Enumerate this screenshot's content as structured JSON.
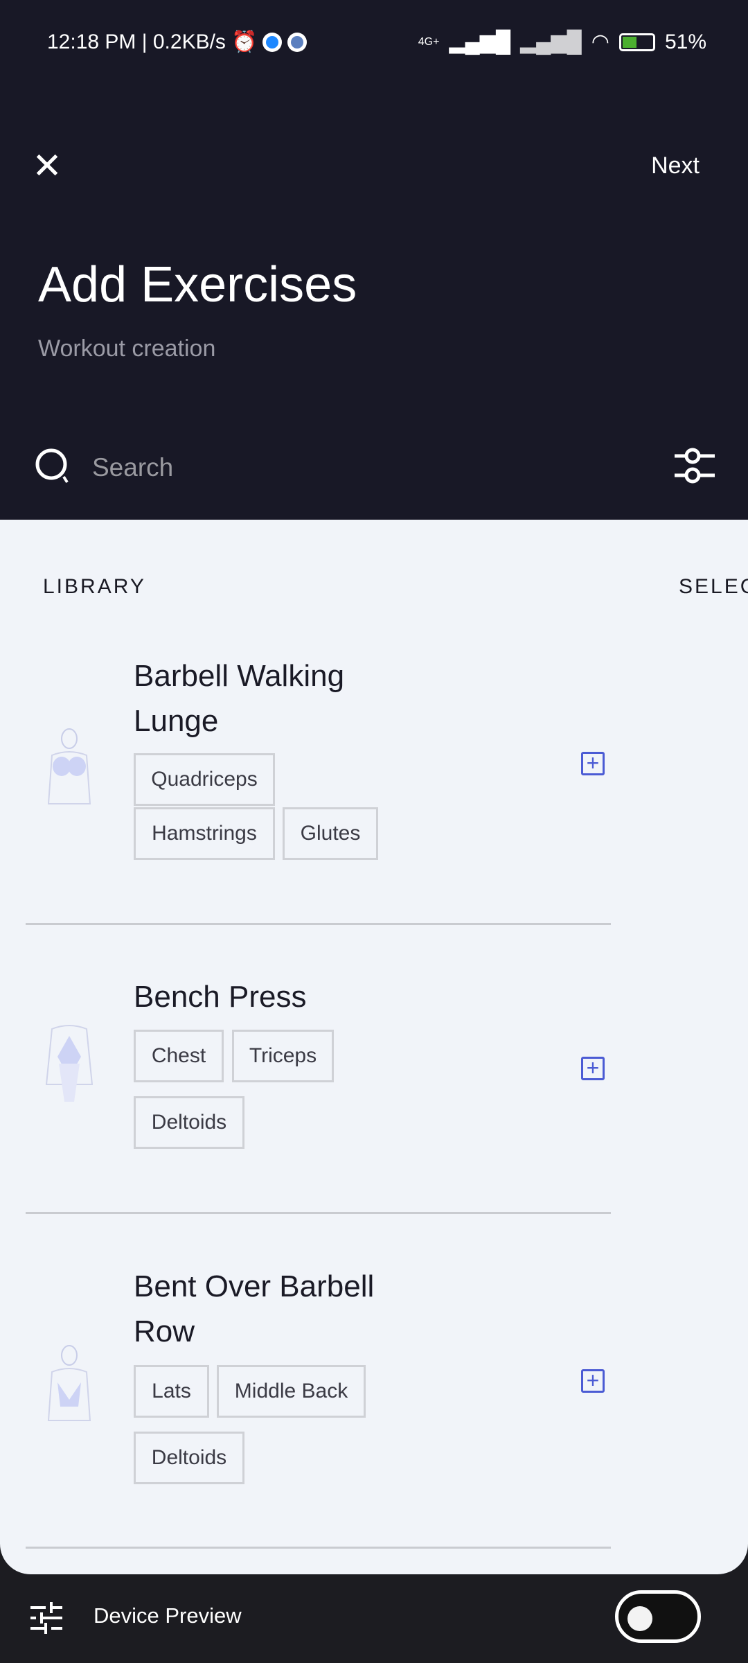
{
  "status_bar": {
    "time": "12:18 PM | 0.2KB/s",
    "network": "4G+",
    "battery": "51%"
  },
  "header": {
    "close_icon": "close-icon",
    "next_label": "Next",
    "title": "Add Exercises",
    "subtitle": "Workout creation"
  },
  "search": {
    "placeholder": "Search",
    "value": ""
  },
  "tabs": {
    "library": "LIBRARY",
    "selected": "SELEC"
  },
  "exercises": [
    {
      "name_lines": [
        "Barbell Walking",
        "Lunge"
      ],
      "muscles": [
        "Quadriceps",
        "Hamstrings",
        "Glutes"
      ]
    },
    {
      "name_lines": [
        "Bench Press"
      ],
      "muscles": [
        "Chest",
        "Triceps",
        "Deltoids"
      ]
    },
    {
      "name_lines": [
        "Bent Over Barbell",
        "Row"
      ],
      "muscles": [
        "Lats",
        "Middle Back",
        "Deltoids"
      ]
    }
  ],
  "colors": {
    "header": "#181826",
    "accent": "#4b5bd4",
    "content": "#f1f4f9"
  },
  "bottom_bar": {
    "label": "Device Preview",
    "toggle_on": false
  }
}
